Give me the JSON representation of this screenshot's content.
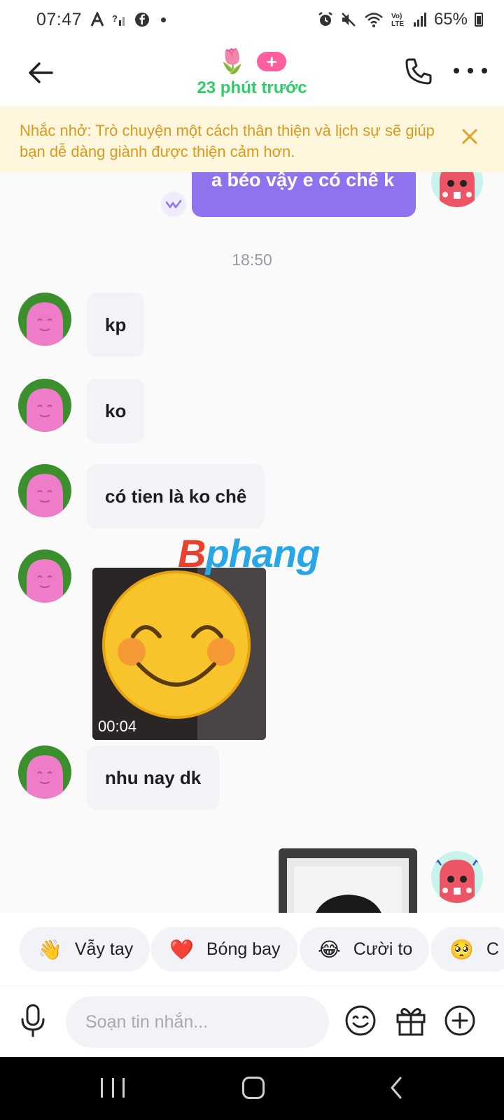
{
  "status_bar": {
    "time": "07:47",
    "battery": "65%"
  },
  "header": {
    "contact_emoji": "🌷",
    "plus_badge": "+",
    "last_seen": "23 phút trước"
  },
  "banner": {
    "text": "Nhắc nhở: Trò chuyện một cách thân thiện và lịch sự sẽ giúp bạn dễ dàng giành được thiện cảm hơn."
  },
  "chat": {
    "outgoing_message": "a béo vậy e có chê k",
    "timestamp": "18:50",
    "incoming": [
      "kp",
      "ko",
      "có tien là ko chê",
      "nhu nay dk"
    ],
    "video_duration": "00:04"
  },
  "watermark": {
    "first": "B",
    "rest": "phang"
  },
  "quick_reactions": [
    {
      "emoji": "👋",
      "label": "Vẫy tay"
    },
    {
      "emoji": "❤️",
      "label": "Bóng bay"
    },
    {
      "emoji": "😂",
      "label": "Cười to"
    },
    {
      "emoji": "🥺",
      "label": "C"
    }
  ],
  "composer": {
    "placeholder": "Soạn tin nhắn..."
  },
  "colors": {
    "accent_purple": "#8e72ee",
    "online_green": "#2ecc6a",
    "banner_text": "#d99a1b",
    "banner_bg": "#fff6de",
    "badge_pink": "#ff5f9e"
  }
}
